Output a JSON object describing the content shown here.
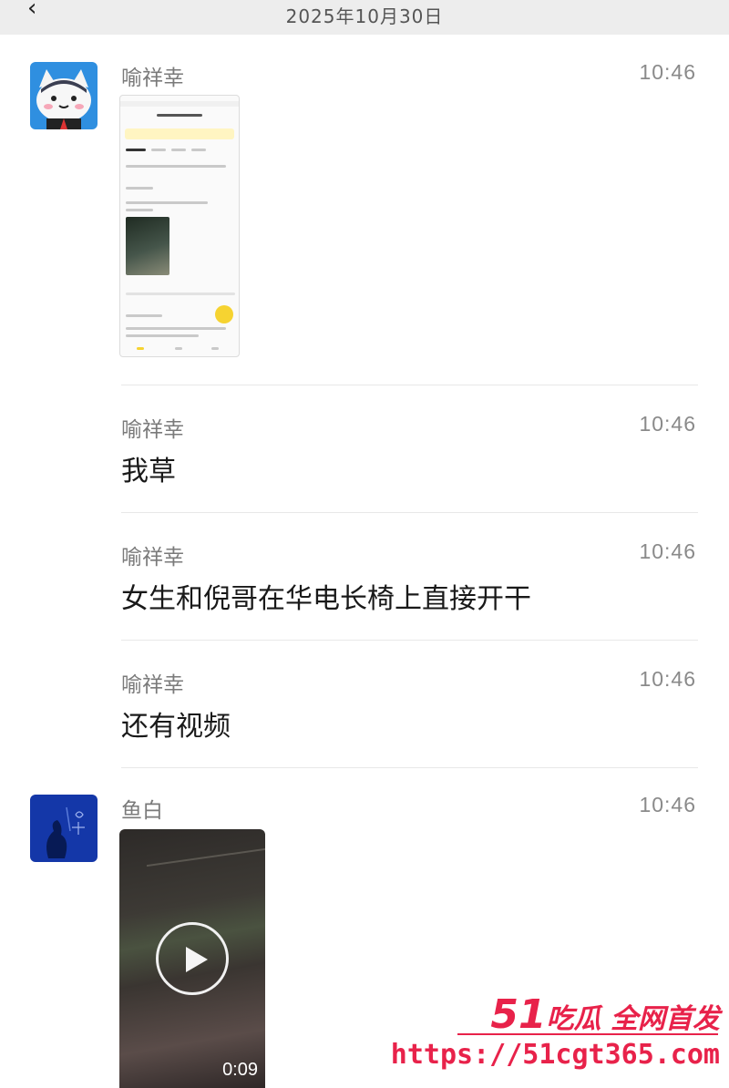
{
  "header": {
    "date": "2025年10月30日",
    "back_icon": "back-arrow-icon"
  },
  "messages": [
    {
      "sender": "喻祥幸",
      "time": "10:46",
      "type": "image"
    },
    {
      "sender": "喻祥幸",
      "time": "10:46",
      "text": "我草"
    },
    {
      "sender": "喻祥幸",
      "time": "10:46",
      "text": "女生和倪哥在华电长椅上直接开干"
    },
    {
      "sender": "喻祥幸",
      "time": "10:46",
      "text": "还有视频"
    },
    {
      "sender": "鱼白",
      "time": "10:46",
      "type": "video",
      "duration": "0:09"
    }
  ],
  "colors": {
    "header_bg": "#ededed",
    "watermark": "#e8224a",
    "avatar1_bg": "#2f8fe0",
    "avatar2_bg": "#1437a8"
  },
  "watermark": {
    "brand_num": "51",
    "brand_text": "吃瓜 全网首发",
    "url": "https://51cgt365.com"
  }
}
